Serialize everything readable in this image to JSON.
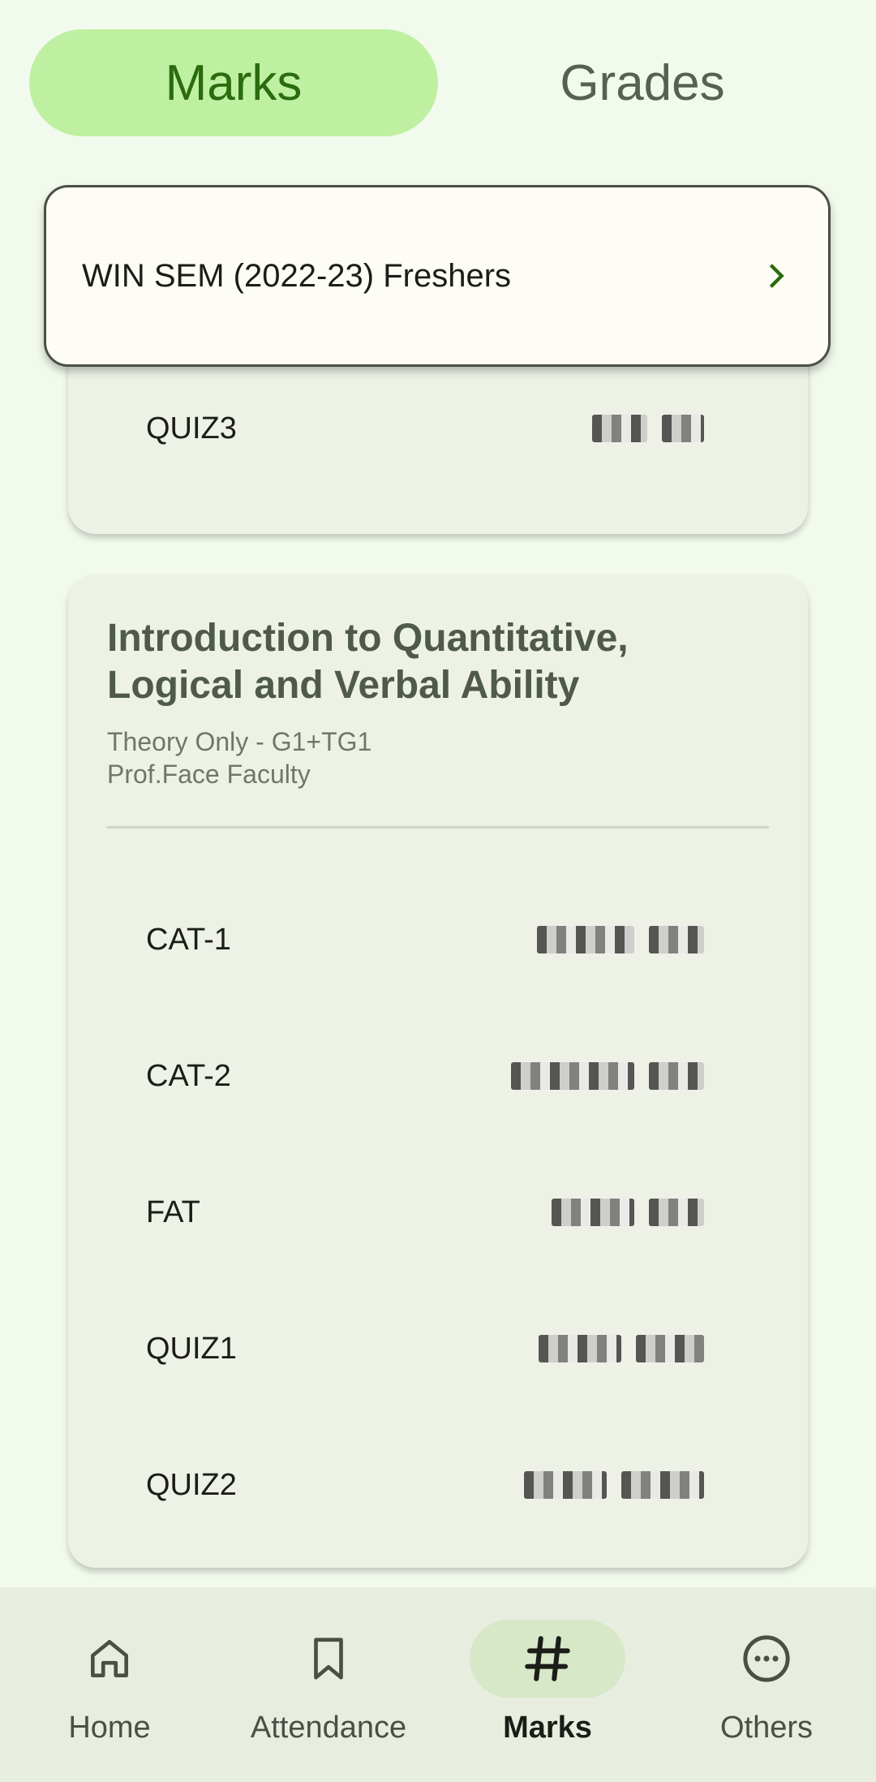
{
  "tabs": {
    "marks": "Marks",
    "grades": "Grades"
  },
  "semester": {
    "label": "WIN SEM (2022-23) Freshers"
  },
  "partial_card": {
    "rows": [
      {
        "label": "QUIZ3"
      }
    ]
  },
  "course": {
    "title": "Introduction to Quantitative, Logical and Verbal Ability",
    "type": "Theory Only - G1+TG1",
    "faculty": "Prof.Face Faculty",
    "rows": [
      {
        "label": "CAT-1"
      },
      {
        "label": "CAT-2"
      },
      {
        "label": "FAT"
      },
      {
        "label": "QUIZ1"
      },
      {
        "label": "QUIZ2"
      }
    ]
  },
  "nav": {
    "home": "Home",
    "attendance": "Attendance",
    "marks": "Marks",
    "others": "Others"
  },
  "colors": {
    "accent": "#2a6b0e",
    "tab_active_bg": "#bff0a2",
    "nav_active_bg": "#d6e8c8"
  }
}
